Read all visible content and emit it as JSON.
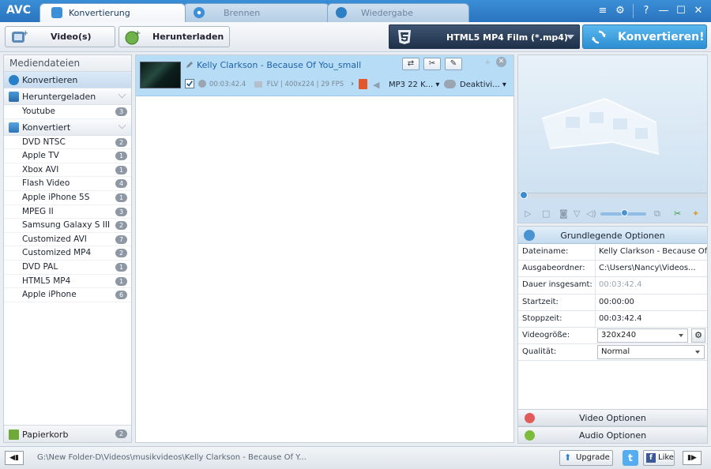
{
  "app": {
    "logo": "AVC"
  },
  "tabs": [
    {
      "label": "Konvertierung",
      "active": true
    },
    {
      "label": "Brennen",
      "active": false
    },
    {
      "label": "Wiedergabe",
      "active": false
    }
  ],
  "window": {
    "menu": "≡",
    "settings": "⚙",
    "help": "?",
    "minimize": "—",
    "maximize": "☐",
    "close": "✕"
  },
  "toolbar": {
    "videos_label": "Video(s)",
    "download_label": "Herunterladen",
    "format_label": "HTML5 MP4 Film (*.mp4)",
    "html5_badge": "5",
    "convert_label": "Konvertieren!"
  },
  "sidebar": {
    "title": "Mediendateien",
    "convert_group": "Konvertieren",
    "downloaded_group": "Heruntergeladen",
    "downloaded_items": [
      {
        "label": "Youtube",
        "count": "3"
      }
    ],
    "converted_group": "Konvertiert",
    "converted_items": [
      {
        "label": "DVD NTSC",
        "count": "2"
      },
      {
        "label": "Apple TV",
        "count": "1"
      },
      {
        "label": "Xbox AVI",
        "count": "1"
      },
      {
        "label": "Flash Video",
        "count": "4"
      },
      {
        "label": "Apple iPhone 5S",
        "count": "1"
      },
      {
        "label": "MPEG II",
        "count": "3"
      },
      {
        "label": "Samsung Galaxy S III",
        "count": "2"
      },
      {
        "label": "Customized AVI",
        "count": "7"
      },
      {
        "label": "Customized MP4",
        "count": "2"
      },
      {
        "label": "DVD PAL",
        "count": "1"
      },
      {
        "label": "HTML5 MP4",
        "count": "1"
      },
      {
        "label": "Apple iPhone",
        "count": "6"
      }
    ],
    "trash_label": "Papierkorb",
    "trash_count": "2"
  },
  "file": {
    "title": "Kelly Clarkson - Because Of You_small",
    "duration": "00:03:42.4",
    "info": "FLV | 400x224 | 29 FPS",
    "audio": "MP3 22 K...",
    "subtitle": "Deaktivi..."
  },
  "options": {
    "header": "Grundlegende Optionen",
    "rows": [
      {
        "label": "Dateiname:",
        "value": "Kelly Clarkson - Because Of..."
      },
      {
        "label": "Ausgabeordner:",
        "value": "C:\\Users\\Nancy\\Videos..."
      },
      {
        "label": "Dauer insgesamt:",
        "value": "00:03:42.4"
      },
      {
        "label": "Startzeit:",
        "value": "00:00:00"
      },
      {
        "label": "Stoppzeit:",
        "value": "00:03:42.4"
      },
      {
        "label": "Videogröße:",
        "value": "320x240"
      },
      {
        "label": "Qualität:",
        "value": "Normal"
      }
    ],
    "video_options": "Video Optionen",
    "audio_options": "Audio Optionen"
  },
  "status": {
    "path": "G:\\New Folder-D\\Videos\\musikvideos\\Kelly Clarkson - Because Of Y...",
    "upgrade_label": "Upgrade",
    "like_label": "Like"
  },
  "colors": {
    "accent": "#2c8ed2",
    "title_bar": "#2a73bf",
    "selection": "#b7dcf6"
  }
}
